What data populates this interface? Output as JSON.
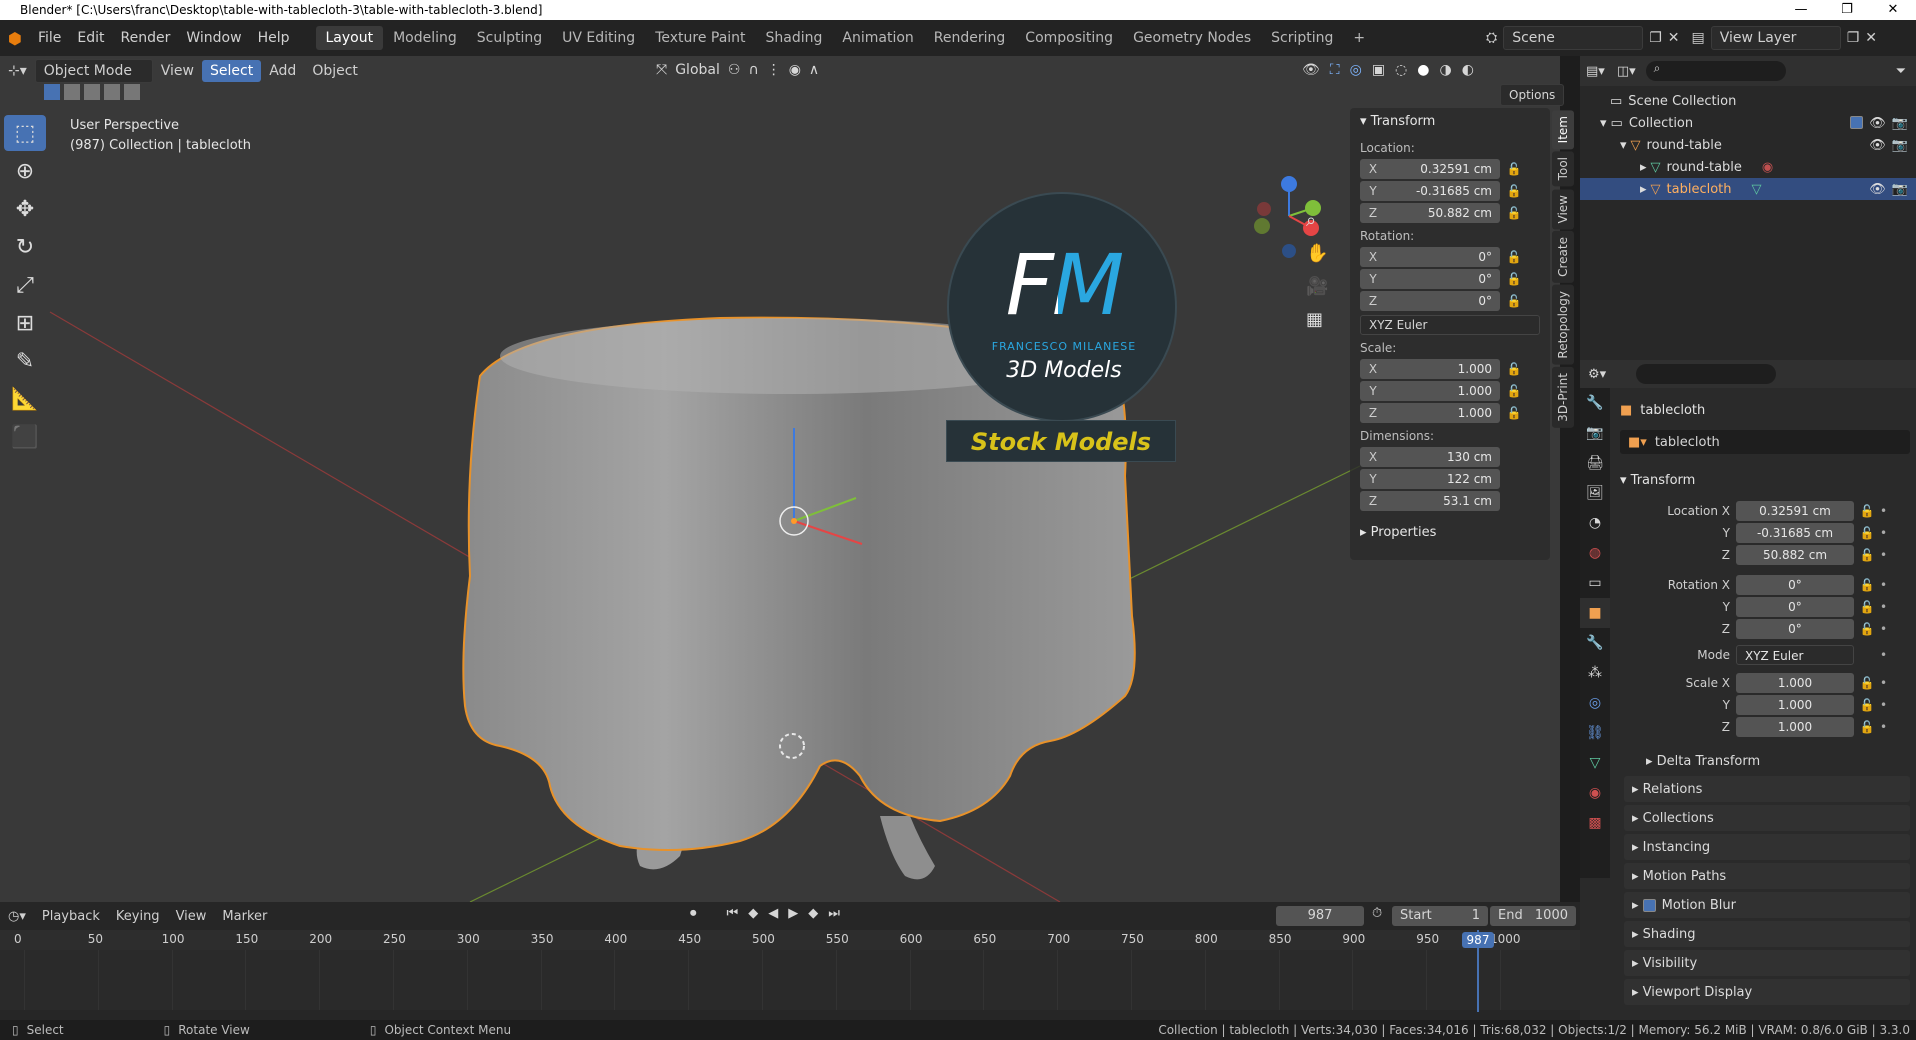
{
  "window": {
    "title": "Blender* [C:\\Users\\franc\\Desktop\\table-with-tablecloth-3\\table-with-tablecloth-3.blend]",
    "min": "—",
    "max": "❐",
    "close": "✕"
  },
  "menu": [
    "File",
    "Edit",
    "Render",
    "Window",
    "Help"
  ],
  "workspaces": [
    "Layout",
    "Modeling",
    "Sculpting",
    "UV Editing",
    "Texture Paint",
    "Shading",
    "Animation",
    "Rendering",
    "Compositing",
    "Geometry Nodes",
    "Scripting"
  ],
  "scene": {
    "label": "Scene",
    "view_layer": "View Layer"
  },
  "viewport": {
    "mode": "Object Mode",
    "menus": [
      "View",
      "Select",
      "Add",
      "Object"
    ],
    "orientation": "Global",
    "options": "Options",
    "overlay_line1": "User Perspective",
    "overlay_line2": "(987) Collection | tablecloth"
  },
  "logo": {
    "initials": "FM",
    "name": "FRANCESCO MILANESE",
    "subtitle": "3D Models",
    "banner": "Stock Models"
  },
  "npanel": {
    "title": "Transform",
    "location_label": "Location:",
    "rotation_label": "Rotation:",
    "scale_label": "Scale:",
    "dimensions_label": "Dimensions:",
    "location": [
      "0.32591 cm",
      "-0.31685 cm",
      "50.882 cm"
    ],
    "rotation": [
      "0°",
      "0°",
      "0°"
    ],
    "rot_mode": "XYZ Euler",
    "scale": [
      "1.000",
      "1.000",
      "1.000"
    ],
    "dimensions": [
      "130 cm",
      "122 cm",
      "53.1 cm"
    ],
    "properties": "Properties",
    "axes": [
      "X",
      "Y",
      "Z"
    ],
    "tabs": [
      "Item",
      "Tool",
      "View",
      "Create",
      "Retopology",
      "3D-Print"
    ]
  },
  "outliner": {
    "scene_collection": "Scene Collection",
    "collection": "Collection",
    "items": [
      "round-table",
      "round-table",
      "tablecloth"
    ]
  },
  "properties": {
    "object_name": "tablecloth",
    "data_name": "tablecloth",
    "section": "Transform",
    "loc_labels": [
      "Location X",
      "Y",
      "Z"
    ],
    "loc": [
      "0.32591 cm",
      "-0.31685 cm",
      "50.882 cm"
    ],
    "rot_labels": [
      "Rotation X",
      "Y",
      "Z"
    ],
    "rot": [
      "0°",
      "0°",
      "0°"
    ],
    "mode_label": "Mode",
    "mode": "XYZ Euler",
    "scale_labels": [
      "Scale X",
      "Y",
      "Z"
    ],
    "scale": [
      "1.000",
      "1.000",
      "1.000"
    ],
    "panels": [
      "Delta Transform",
      "Relations",
      "Collections",
      "Instancing",
      "Motion Paths",
      "Motion Blur",
      "Shading",
      "Visibility",
      "Viewport Display"
    ]
  },
  "timeline": {
    "menus": [
      "Playback",
      "Keying",
      "View",
      "Marker"
    ],
    "current": "987",
    "start_label": "Start",
    "start": "1",
    "end_label": "End",
    "end": "1000",
    "ticks": [
      "0",
      "50",
      "100",
      "150",
      "200",
      "250",
      "300",
      "350",
      "400",
      "450",
      "500",
      "550",
      "600",
      "650",
      "700",
      "750",
      "800",
      "850",
      "900",
      "950",
      "1000"
    ]
  },
  "status": {
    "select": "Select",
    "rotate": "Rotate View",
    "context": "Object Context Menu",
    "stats": "Collection | tablecloth | Verts:34,030 | Faces:34,016 | Tris:68,032 | Objects:1/2 | Memory: 56.2 MiB | VRAM: 0.8/6.0 GiB | 3.3.0"
  }
}
